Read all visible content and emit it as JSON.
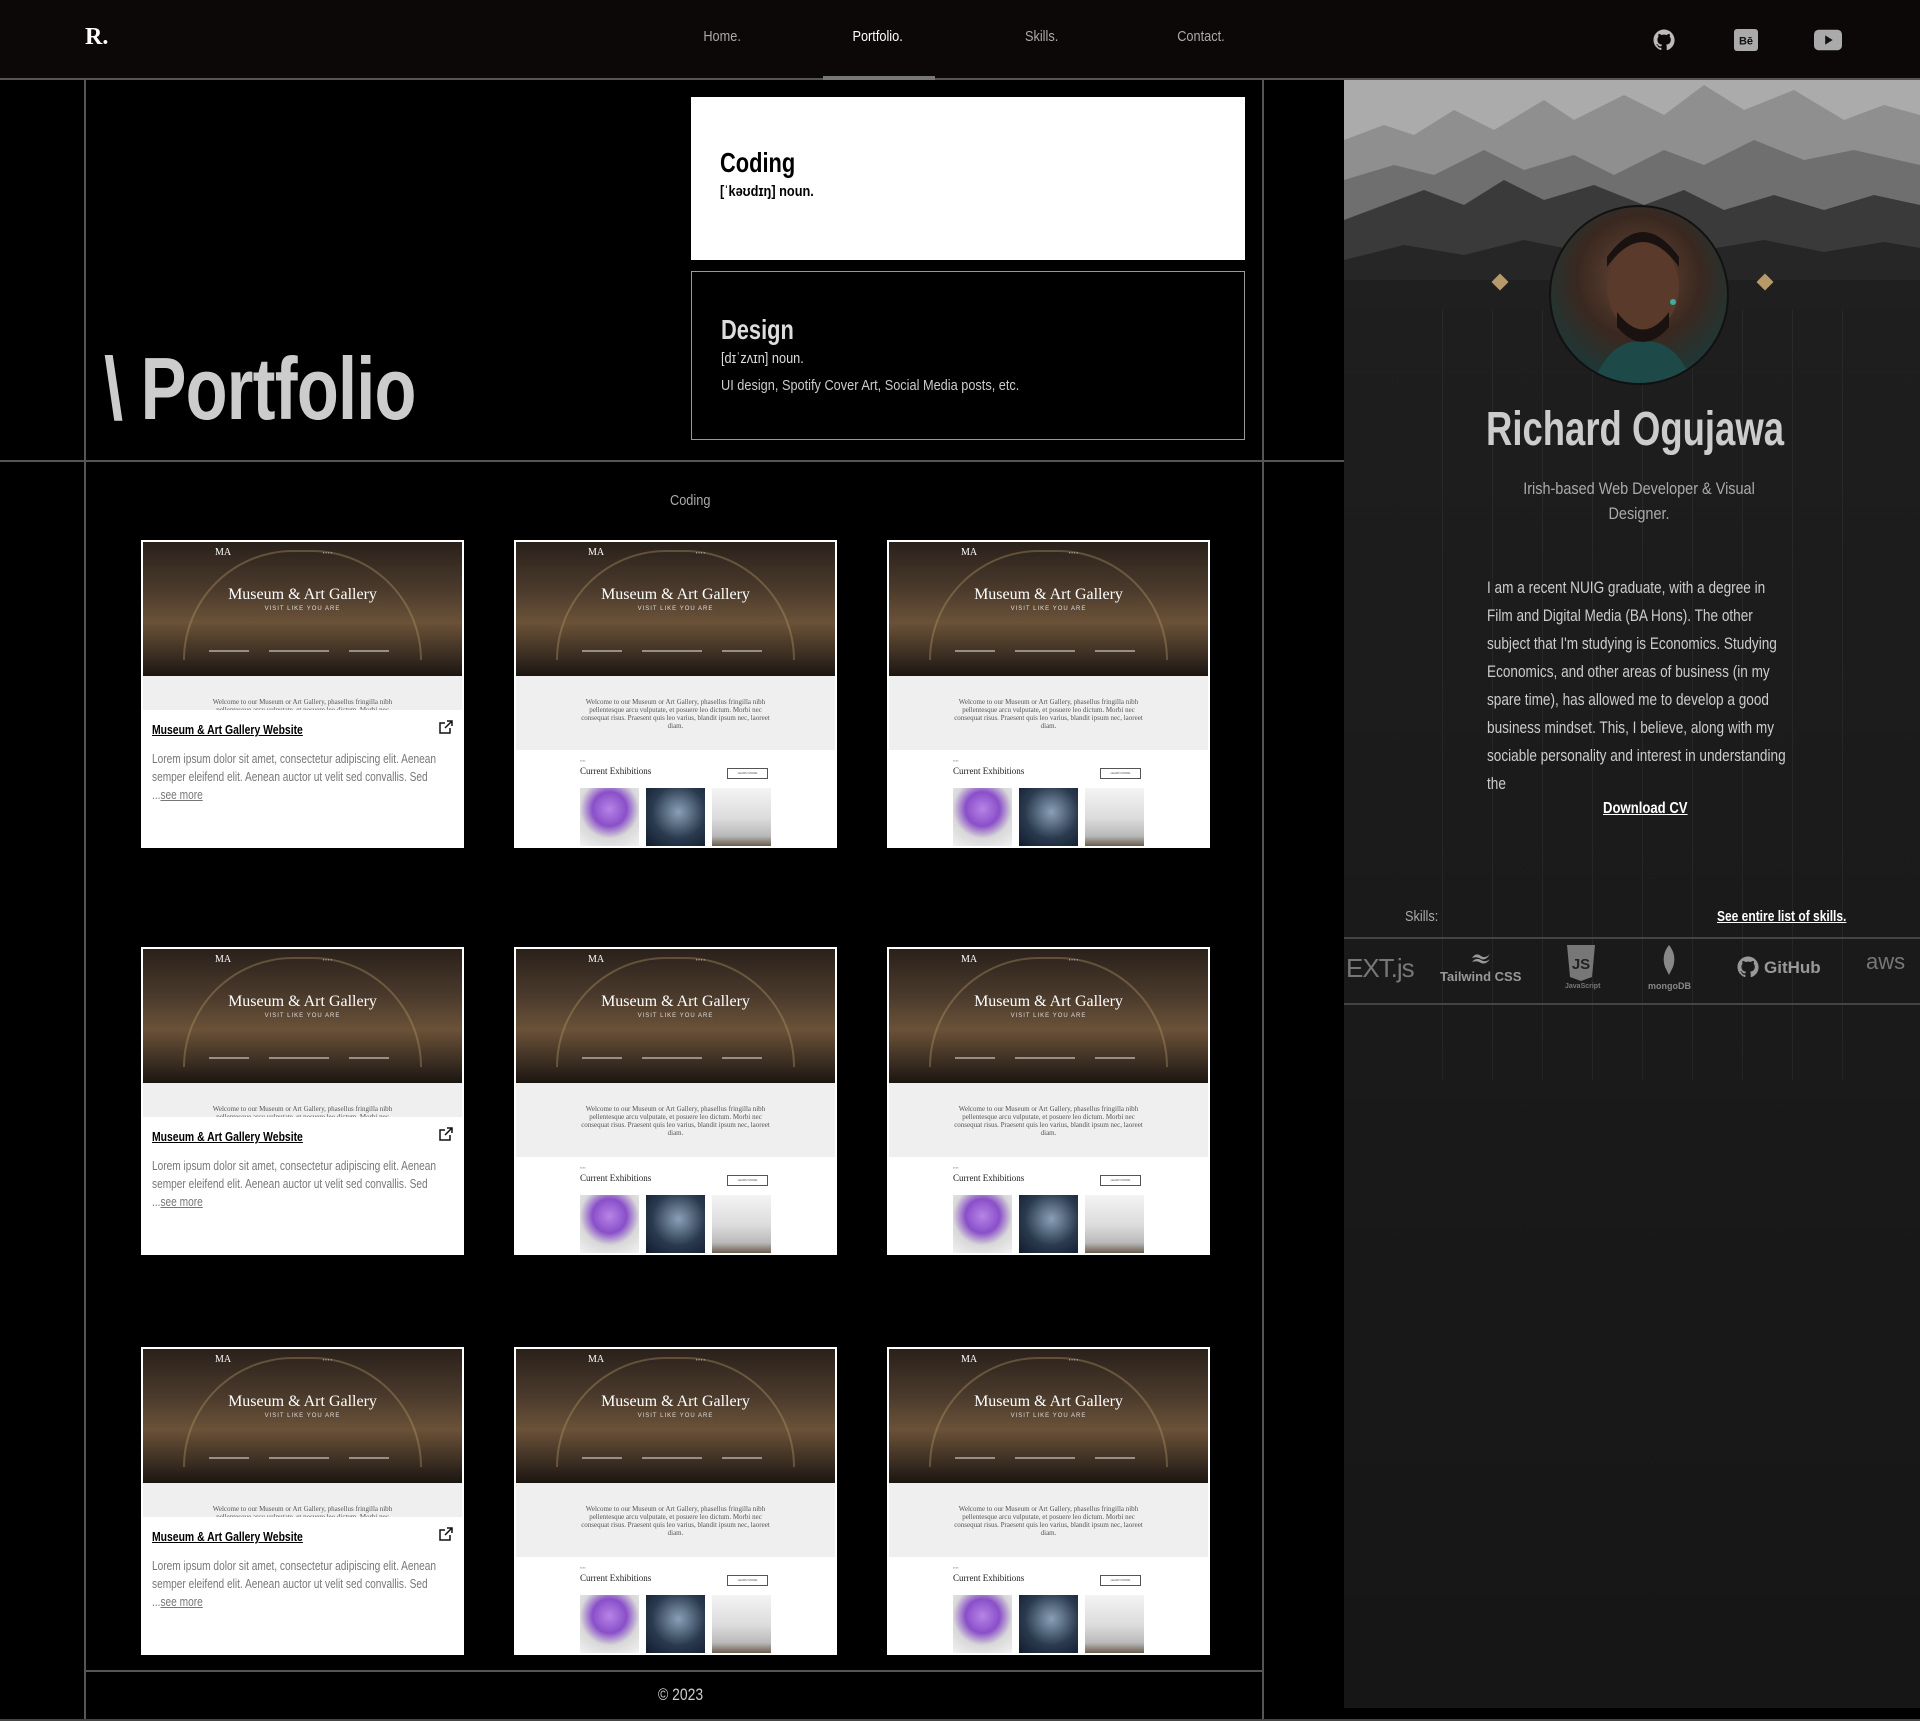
{
  "header": {
    "logo": "R.",
    "nav": [
      {
        "label": "Home.",
        "active": false
      },
      {
        "label": "Portfolio.",
        "active": true
      },
      {
        "label": "Skills.",
        "active": false
      },
      {
        "label": "Contact.",
        "active": false
      }
    ],
    "social_icons": [
      "github-icon",
      "behance-icon",
      "youtube-icon"
    ]
  },
  "hero": {
    "title": "\\ Portfolio",
    "definitions": [
      {
        "word": "Coding",
        "pronunciation": "[ˈkəʊdɪŋ] noun.",
        "description": ""
      },
      {
        "word": "Design",
        "pronunciation": "[dɪˈzʌɪn] noun.",
        "description": "UI design, Spotify Cover Art, Social Media posts, etc."
      }
    ]
  },
  "portfolio": {
    "section_label": "Coding",
    "cards": [
      {
        "title": "Museum & Art Gallery Website",
        "description": "Lorem ipsum dolor sit amet, consectetur adipiscing elit. Aenean semper eleifend elit. Aenean auctor ut velit sed convallis. Sed ...",
        "more": "see more",
        "expanded": true
      },
      {
        "expanded": false
      },
      {
        "expanded": false
      },
      {
        "title": "Museum & Art Gallery Website",
        "description": "Lorem ipsum dolor sit amet, consectetur adipiscing elit. Aenean semper eleifend elit. Aenean auctor ut velit sed convallis. Sed ...",
        "more": "see more",
        "expanded": true
      },
      {
        "expanded": false
      },
      {
        "expanded": false
      },
      {
        "title": "Museum & Art Gallery Website",
        "description": "Lorem ipsum dolor sit amet, consectetur adipiscing elit. Aenean semper eleifend elit. Aenean auctor ut velit sed convallis. Sed ...",
        "more": "see more",
        "expanded": true
      },
      {
        "expanded": false
      },
      {
        "expanded": false
      }
    ],
    "preview": {
      "brand": "MA",
      "heading": "Museum & Art Gallery",
      "subheading": "VISIT LIKE YOU ARE",
      "welcome": "Welcome to our Museum or Art Gallery, phasellus fringilla nibh pellentesque arcu vulputate, et posuere leo dictum. Morbi nec consequat risus. Praesent quis leo varius, blandit ipsum nec, laoreet diam.",
      "exhibitions_label": "Current Exhibitions",
      "exhibitions_button": "LEARN MORE"
    }
  },
  "sidebar": {
    "name": "Richard Ogujawa",
    "role": "Irish-based Web Developer & Visual Designer.",
    "bio": "I am a recent NUIG graduate, with a degree in Film and Digital Media (BA Hons). The other subject that I'm studying is Economics. Studying Economics, and other areas of business (in my spare time), has allowed me to develop a good business mindset. This, I believe, along with my sociable personality and interest in understanding the",
    "download_cv": "Download CV",
    "skills_label": "Skills:",
    "skills_link": "See entire list of skills.",
    "skill_logos": [
      "EXT.js",
      "Tailwind CSS",
      "JavaScript",
      "mongoDB",
      "GitHub",
      "aws"
    ]
  },
  "footer": {
    "copyright": "© 2023"
  },
  "colors": {
    "background": "#000000",
    "header_bg": "#0c0807",
    "sidebar_bg": "#1a1a1a",
    "text_light": "#cccccc",
    "card_bg": "#ffffff"
  }
}
